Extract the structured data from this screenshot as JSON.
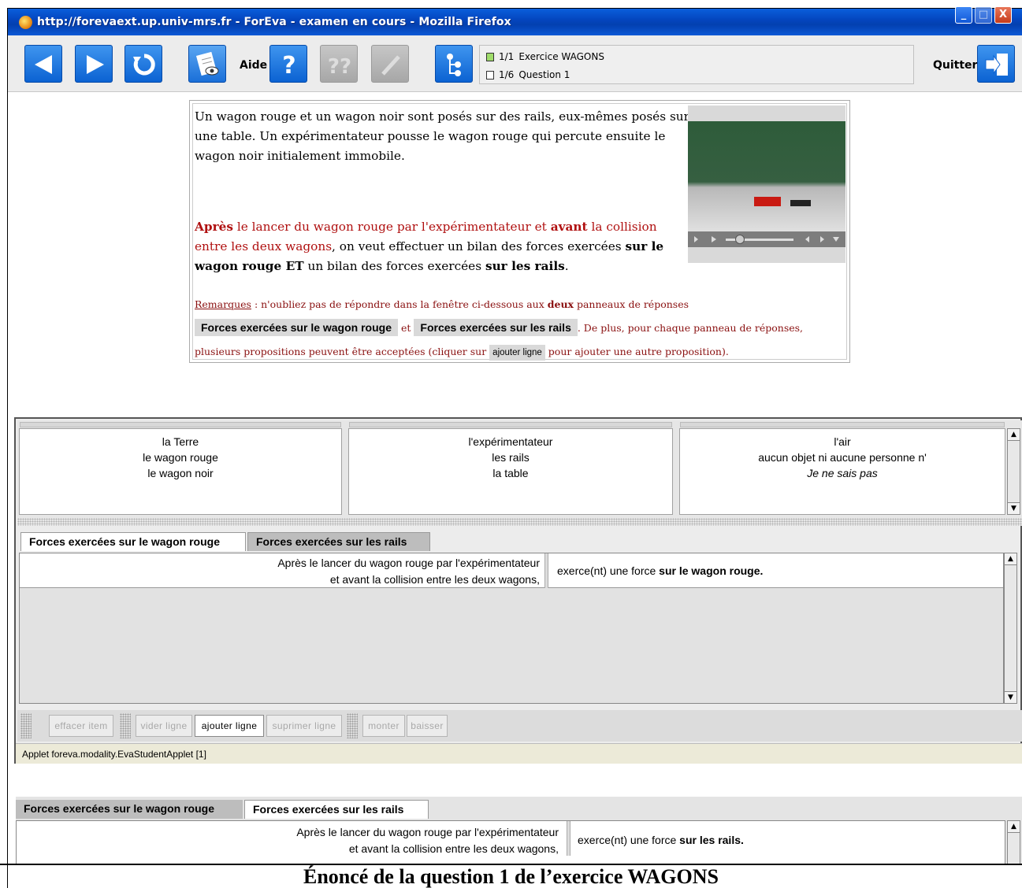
{
  "window": {
    "title": "http://forevaext.up.univ-mrs.fr - ForEva - examen en cours - Mozilla Firefox",
    "controls": {
      "minimize": "_",
      "maximize": "□",
      "close": "X"
    }
  },
  "toolbar": {
    "aide_label": "Aide",
    "quit_label": "Quitter",
    "exercise_counter": "1/1",
    "exercise_name": "Exercice WAGONS",
    "question_counter": "1/6",
    "question_name": "Question 1",
    "icons": [
      "back-arrow-icon",
      "forward-arrow-icon",
      "refresh-icon",
      "document-view-icon",
      "help-icon",
      "help-disabled-icon",
      "edit-disabled-icon",
      "tree-icon",
      "exit-door-icon"
    ]
  },
  "statement": {
    "intro": "Un wagon rouge et un wagon noir sont posés sur des rails, eux-mêmes posés sur une table. Un expérimentateur pousse le wagon rouge qui percute ensuite le wagon noir initialement immobile.",
    "p2_apres": "Après",
    "p2_a": " le lancer du wagon rouge par l'expérimentateur et ",
    "p2_avant": "avant",
    "p2_b": " la collision entre les deux wagons",
    "p2_c": ", on veut effectuer un bilan des forces exercées ",
    "p2_sur_wagon": "sur le wagon rouge ET",
    "p2_d": " un bilan des forces exercées ",
    "p2_sur_rails": "sur les rails",
    "p2_end": ".",
    "remarques_label": "Remarques",
    "remarques_a": " : n'oubliez pas de répondre dans la fenêtre ci-dessous aux ",
    "remarques_deux": "deux",
    "remarques_b": " panneaux de réponses",
    "tab_wagon": "Forces exercées sur le wagon rouge",
    "et": "et",
    "tab_rails": "Forces exercées sur les rails",
    "remarques_c": ". De plus, pour chaque panneau de réponses,",
    "remarques_d": "plusieurs propositions peuvent être acceptées (cliquer sur ",
    "ajouter_ligne": "ajouter ligne",
    "remarques_e": " pour ajouter une autre proposition)."
  },
  "word_columns": [
    [
      "la Terre",
      "le wagon rouge",
      "le wagon noir"
    ],
    [
      "l'expérimentateur",
      "les rails",
      "la table"
    ],
    [
      "l'air",
      "aucun objet ni aucune personne n'",
      "Je ne sais pas"
    ]
  ],
  "panel_top": {
    "tabs": [
      "Forces exercées sur le wagon rouge",
      "Forces exercées sur les rails"
    ],
    "active_tab": 0,
    "left_line1": "Après le lancer du  wagon rouge par l'expérimentateur",
    "left_line2": "et avant la collision entre les deux wagons,",
    "right_prefix": "exerce(nt) une force ",
    "right_bold": "sur le wagon rouge."
  },
  "actions": {
    "effacer_item": "effacer item",
    "vider_ligne": "vider ligne",
    "ajouter_ligne": "ajouter ligne",
    "supprimer_ligne": "suprimer ligne",
    "monter": "monter",
    "baisser": "baisser"
  },
  "status": "Applet foreva.modality.EvaStudentApplet [1]",
  "panel_bottom": {
    "tabs": [
      "Forces exercées sur le wagon rouge",
      "Forces exercées sur les rails"
    ],
    "active_tab": 1,
    "left_line1": "Après le lancer du wagon rouge par l'expérimentateur",
    "left_line2": "et avant la collision entre les deux wagons,",
    "right_prefix": "exerce(nt) une force ",
    "right_bold": "sur les rails."
  },
  "caption": "Énoncé de la question 1 de l’exercice WAGONS",
  "colors": {
    "titlebar": "#0446bf",
    "toolbar_button": "#0b62d2",
    "emphasis_red": "#b01010"
  }
}
